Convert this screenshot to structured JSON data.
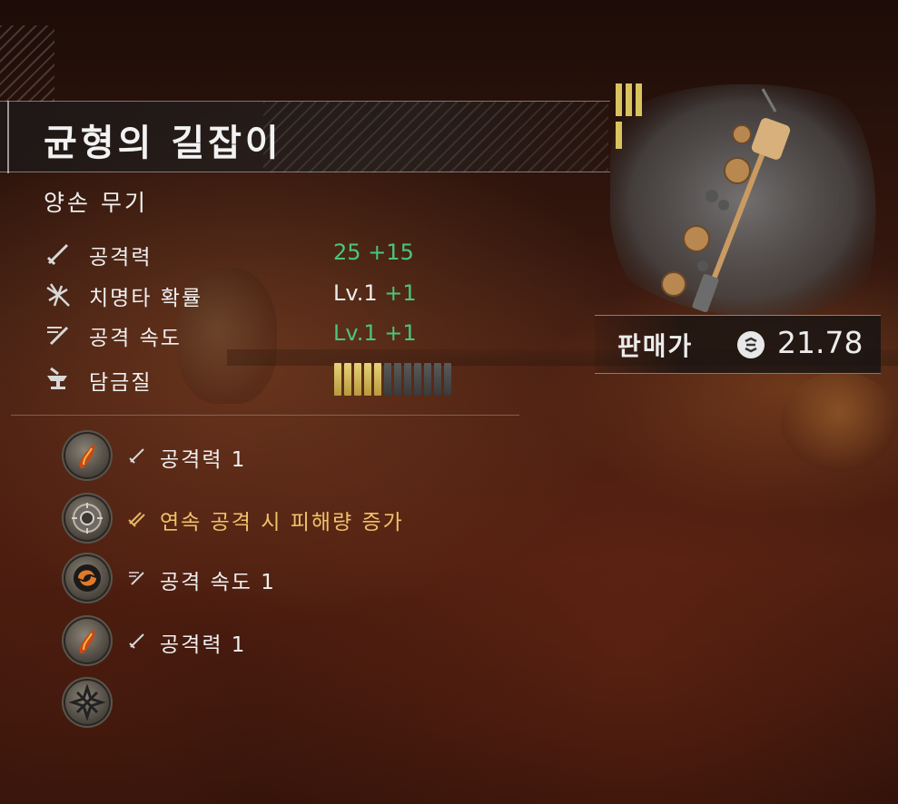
{
  "item": {
    "name": "균형의 길잡이",
    "type": "양손 무기",
    "tier_icon": "tier-bars-icon"
  },
  "stats": [
    {
      "icon": "sword-icon",
      "label": "공격력",
      "base": "25",
      "bonus": "+15"
    },
    {
      "icon": "critical-slash-icon",
      "label": "치명타 확률",
      "base": "Lv.1",
      "bonus": "+1"
    },
    {
      "icon": "attack-speed-icon",
      "label": "공격 속도",
      "base": "Lv.1",
      "bonus": "+1"
    },
    {
      "icon": "anvil-icon",
      "label": "담금질",
      "forge_level": 5,
      "forge_max": 12
    }
  ],
  "perks": [
    {
      "medallion": "flame-blade-medallion",
      "small_icon": "sword-icon",
      "label": "공격력 1",
      "highlight": false
    },
    {
      "medallion": "ornate-shield-medallion",
      "small_icon": "double-sword-icon",
      "label": "연속 공격 시 피해량 증가",
      "highlight": true
    },
    {
      "medallion": "swirl-medallion",
      "small_icon": "attack-speed-icon",
      "label": "공격 속도 1",
      "highlight": false
    },
    {
      "medallion": "flame-blade-medallion",
      "small_icon": "sword-icon",
      "label": "공격력 1",
      "highlight": false
    },
    {
      "medallion": "empty-socket-medallion",
      "small_icon": "",
      "label": "",
      "highlight": false
    }
  ],
  "price": {
    "label": "판매가",
    "icon": "coin-icon",
    "value": "21.78"
  },
  "colors": {
    "bonus_green": "#49c77c",
    "highlight_gold": "#f0c26a",
    "forge_on": "#d9c36a",
    "forge_off": "#4a4a4a"
  }
}
